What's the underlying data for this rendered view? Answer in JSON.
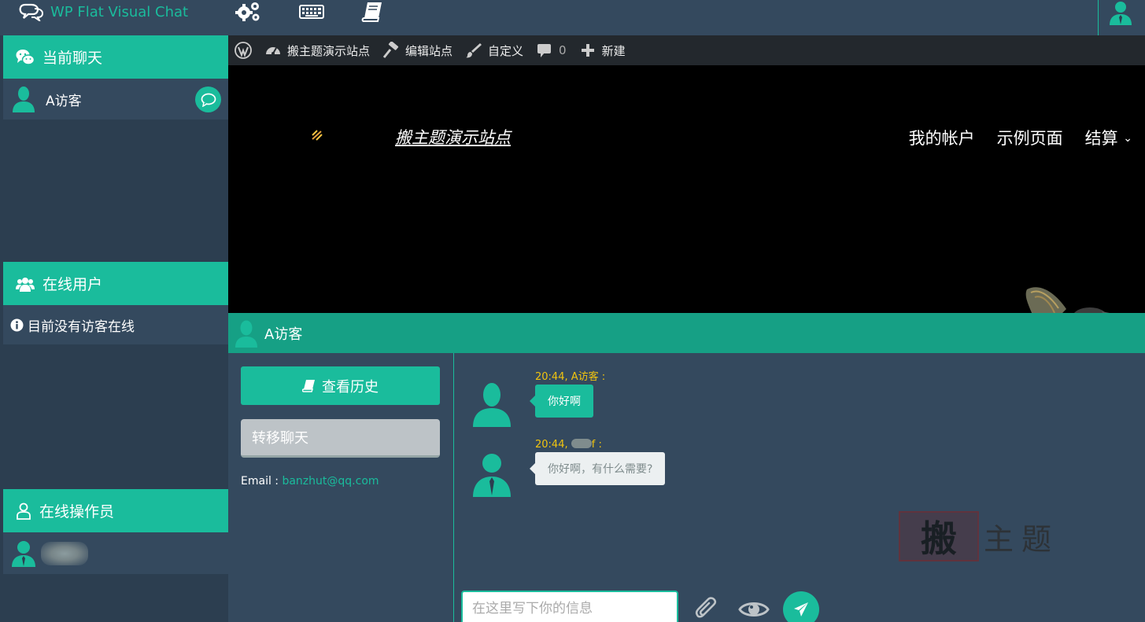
{
  "app": {
    "title": "WP Flat Visual Chat"
  },
  "sidebar": {
    "current_chats_title": "当前聊天",
    "current_chats": [
      {
        "name": "A访客"
      }
    ],
    "online_users_title": "在线用户",
    "online_users_empty": "目前没有访客在线",
    "operators_title": "在线操作员"
  },
  "adminbar": {
    "site": "搬主题演示站点",
    "edit": "编辑站点",
    "customize": "自定义",
    "comments": "0",
    "new": "新建"
  },
  "site": {
    "title": "搬主题演示站点",
    "nav": [
      "我的帐户",
      "示例页面",
      "结算"
    ]
  },
  "chat": {
    "visitor": "A访客",
    "history_button": "查看历史",
    "transfer_button": "转移聊天",
    "email_label": "Email :",
    "email": "banzhut@qq.com",
    "messages": [
      {
        "time": "20:44, A访客 :",
        "text": "你好啊",
        "style": "green"
      },
      {
        "time_prefix": "20:44,",
        "time_suffix": "f :",
        "text": "你好啊，有什么需要?",
        "style": "white"
      }
    ],
    "input_placeholder": "在这里写下你的信息"
  },
  "watermark": {
    "seal": "搬",
    "text": "主题"
  },
  "colors": {
    "accent": "#1abc9c",
    "accent_dark": "#16a085",
    "panel": "#34495e",
    "bg": "#2c3e50",
    "adminbar": "#23282d",
    "time": "#f1c40f"
  }
}
